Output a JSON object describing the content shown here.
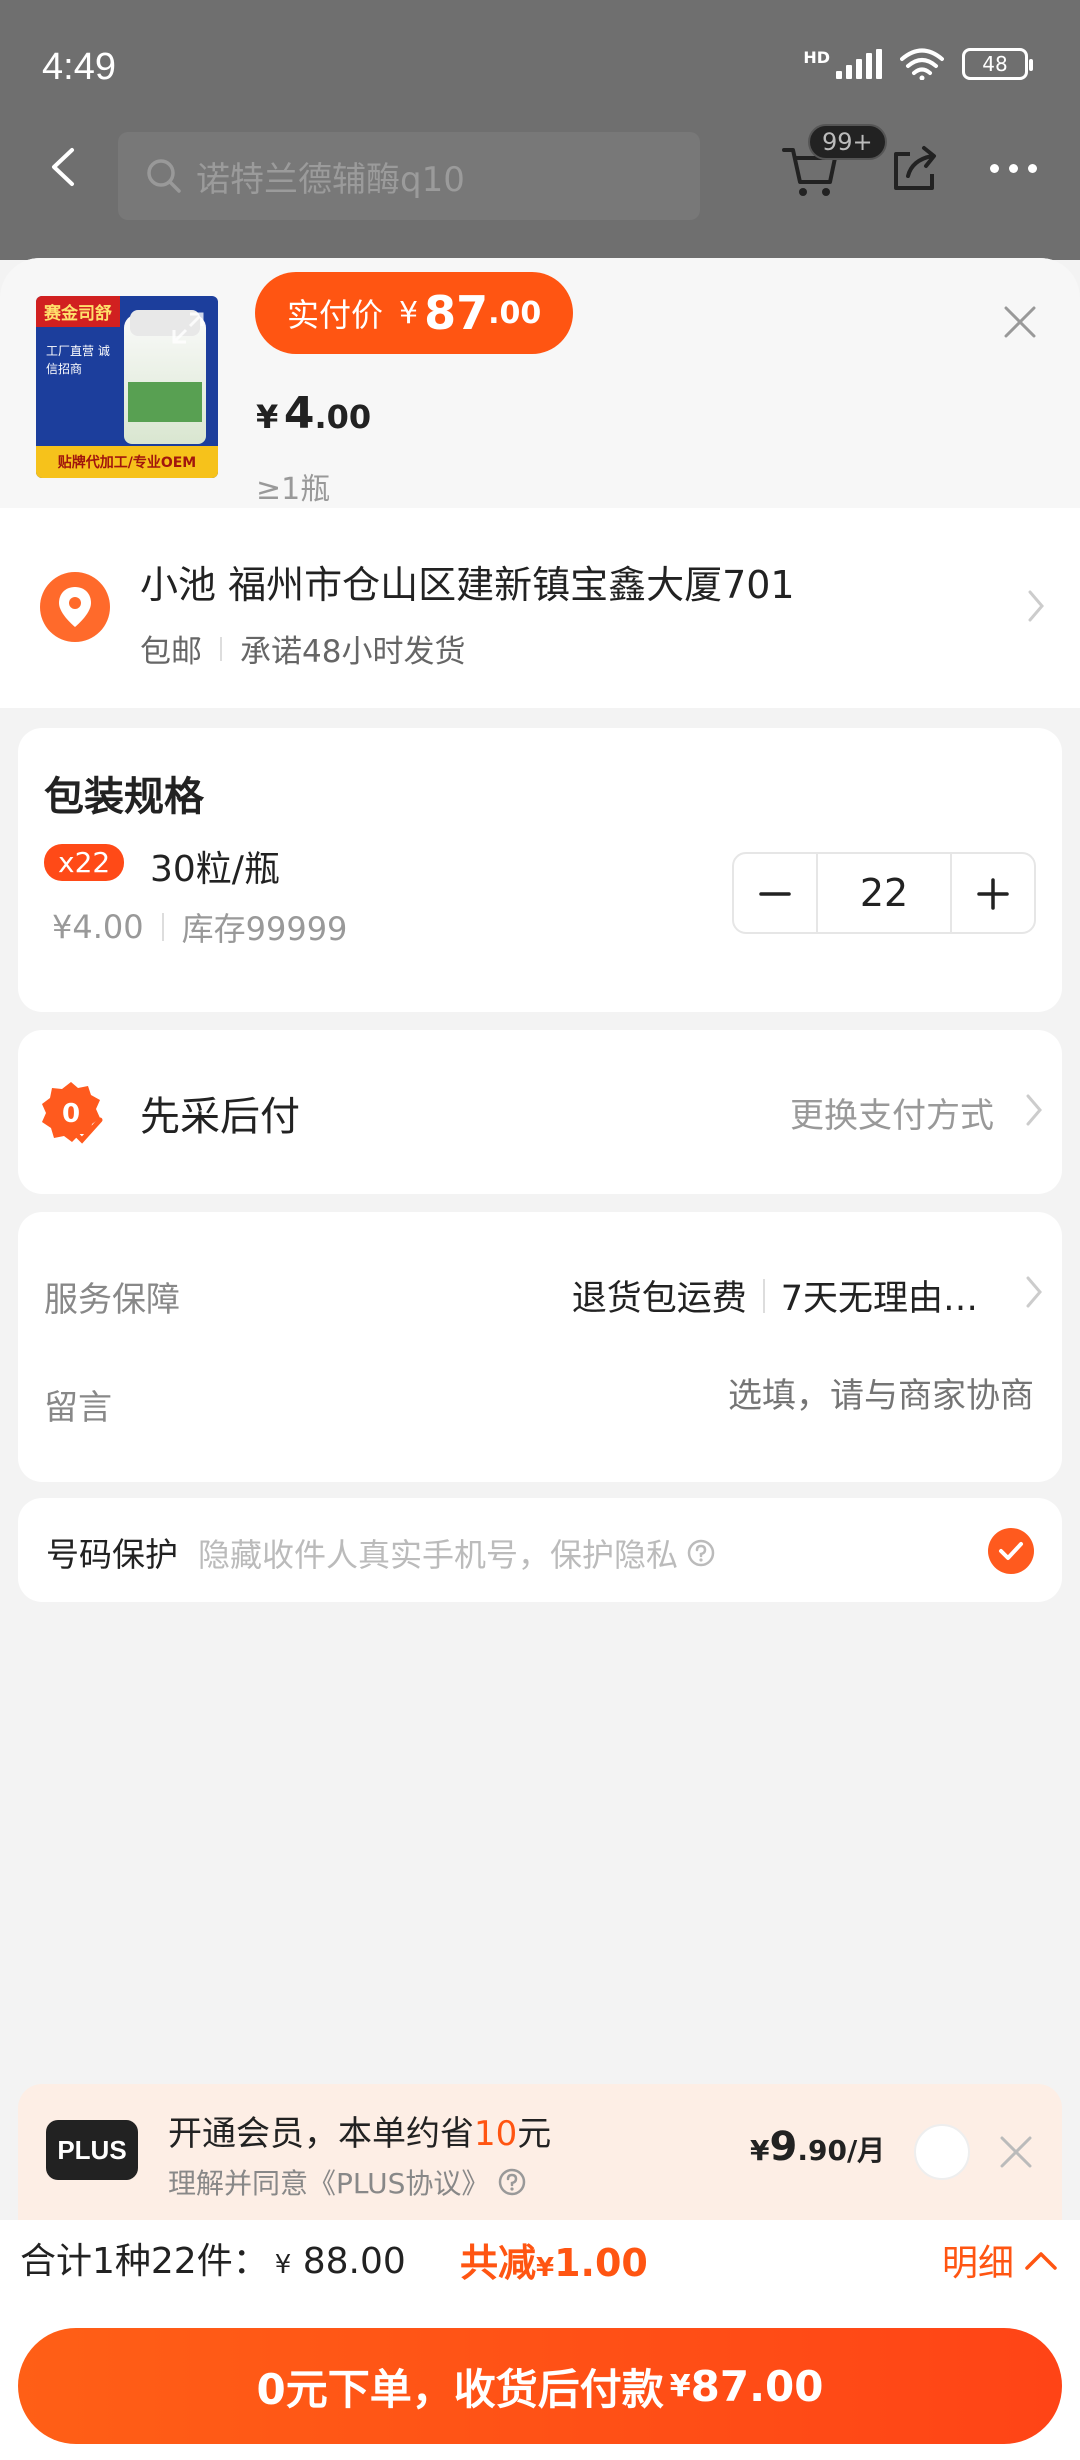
{
  "status_bar": {
    "time": "4:49",
    "network": "HD",
    "battery": "48"
  },
  "top_nav": {
    "search_placeholder": "诺特兰德辅酶q10",
    "cart_badge": "99+"
  },
  "product": {
    "thumb_tag": "赛金司舒",
    "thumb_bullets": "工厂直营 诚信招商",
    "thumb_banner": "贴牌代加工/专业OEM",
    "actual_price_label": "实付价",
    "currency": "¥",
    "actual_price_int": "87",
    "actual_price_dec": ".00",
    "unit_price_int": "4",
    "unit_price_dec": ".00",
    "min_qty": "≥1瓶"
  },
  "address": {
    "recipient_and_address": "小池 福州市仓山区建新镇宝鑫大厦701",
    "shipping": "包邮",
    "promise": "承诺48小时发货"
  },
  "spec": {
    "title": "包装规格",
    "qty_badge": "x22",
    "name": "30粒/瓶",
    "price": "¥4.00",
    "stock": "库存99999",
    "quantity": "22"
  },
  "payment": {
    "label": "先采后付",
    "change": "更换支付方式"
  },
  "service": {
    "label": "服务保障",
    "item1": "退货包运费",
    "item2": "7天无理由…",
    "message_label": "留言",
    "message_placeholder": "选填，请与商家协商"
  },
  "privacy": {
    "label": "号码保护",
    "desc": "隐藏收件人真实手机号，保护隐私",
    "checked": true
  },
  "plus": {
    "logo": "PLUS",
    "title_pre": "开通会员，本单约省",
    "title_amount": "10",
    "title_post": "元",
    "agreement": "理解并同意《PLUS协议》",
    "price_int": "9",
    "price_dec": ".90",
    "price_unit": "/月"
  },
  "summary": {
    "total_label": "合计1种22件：",
    "total_amount": "88.00",
    "discount_label": "共减",
    "discount_amount": "1.00",
    "detail": "明细"
  },
  "order_button": {
    "label": "0元下单，收货后付款",
    "amount": "87.00"
  },
  "colors": {
    "accent": "#ff5512",
    "plus_bg": "#fdeee5"
  }
}
